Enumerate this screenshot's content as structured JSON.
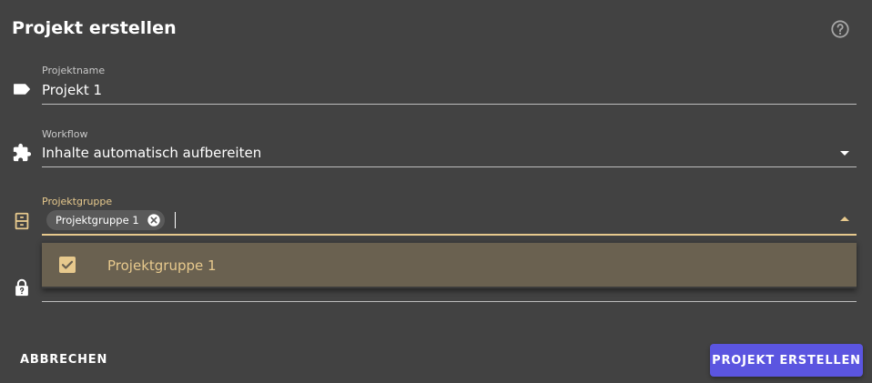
{
  "dialog": {
    "title": "Projekt erstellen"
  },
  "fields": {
    "project_name": {
      "label": "Projektname",
      "value": "Projekt 1",
      "icon": "label-icon"
    },
    "workflow": {
      "label": "Workflow",
      "value": "Inhalte automatisch aufbereiten",
      "icon": "puzzle-icon"
    },
    "project_group": {
      "label": "Projektgruppe",
      "chips": [
        "Projektgruppe 1"
      ],
      "icon": "archive-icon",
      "dropdown_open": true
    },
    "access": {
      "icon": "lock-icon"
    }
  },
  "dropdown": {
    "options": [
      {
        "label": "Projektgruppe 1",
        "checked": true
      }
    ]
  },
  "actions": {
    "cancel_label": "ABBRECHEN",
    "create_label": "PROJEKT ERSTELLEN"
  },
  "colors": {
    "background": "#424242",
    "accent": "#e7c98d",
    "primary_button": "#5b55e0",
    "selected_option": "#6a6150"
  }
}
